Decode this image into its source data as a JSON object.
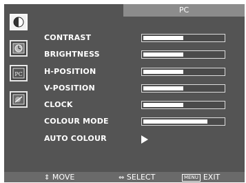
{
  "header": {
    "title": "PC"
  },
  "sidebar": {
    "icons": [
      {
        "name": "picture-icon",
        "selected": true
      },
      {
        "name": "clock-icon",
        "selected": false
      },
      {
        "name": "pc-icon",
        "selected": false
      },
      {
        "name": "image-settings-icon",
        "selected": false
      }
    ]
  },
  "menu": {
    "items": [
      {
        "label": "CONTRAST",
        "level": 0.5
      },
      {
        "label": "BRIGHTNESS",
        "level": 0.5
      },
      {
        "label": "H-POSITION",
        "level": 0.5
      },
      {
        "label": "V-POSITION",
        "level": 0.5
      },
      {
        "label": "CLOCK",
        "level": 0.5
      },
      {
        "label": "COLOUR MODE",
        "level": 0.8
      },
      {
        "label": "AUTO COLOUR",
        "action": "play-arrow-icon"
      }
    ]
  },
  "footer": {
    "move": "MOVE",
    "select": "SELECT",
    "menu_key": "MENU",
    "exit": "EXIT"
  },
  "colors": {
    "panel": "#545454",
    "title_bg": "#8c8c8c",
    "text": "#ffffff"
  }
}
